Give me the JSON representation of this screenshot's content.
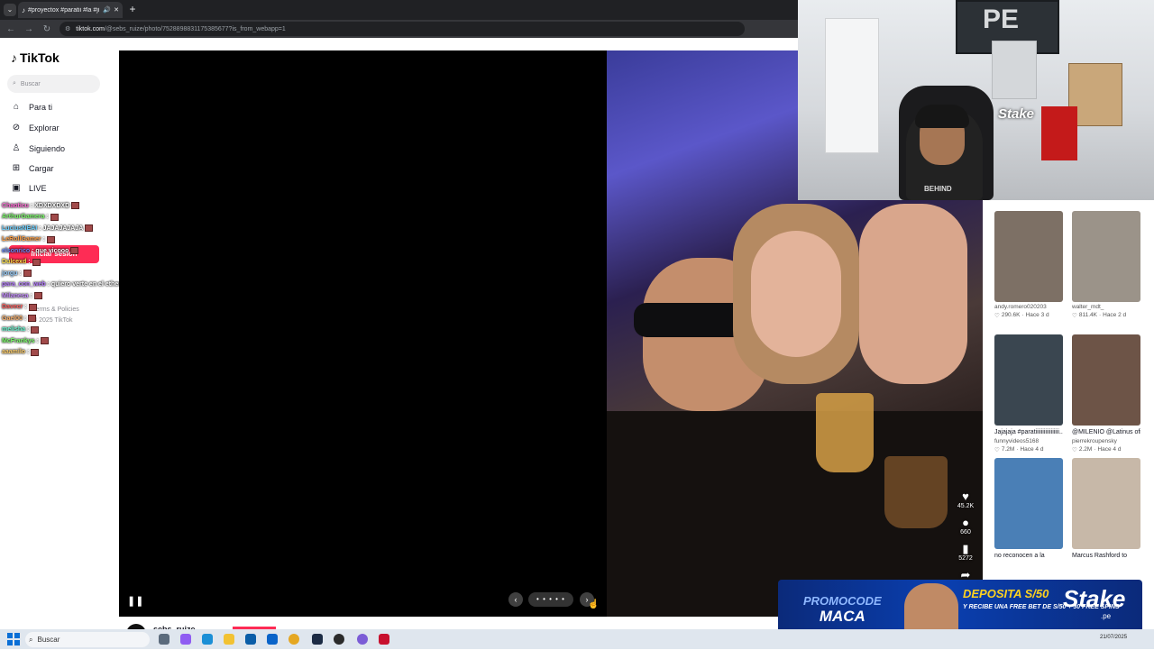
{
  "browser": {
    "tab_title": "#proyectox #paratii #la #ji",
    "url_host": "tiktok.com",
    "url_path": "/@sebs_ruize/photo/7528898831175385677?is_from_webapp=1"
  },
  "tiktok": {
    "logo": "TikTok",
    "search_placeholder": "Buscar",
    "nav": [
      {
        "label": "Para ti",
        "icon": "home-icon"
      },
      {
        "label": "Explorar",
        "icon": "compass-icon"
      },
      {
        "label": "Siguiendo",
        "icon": "following-icon"
      },
      {
        "label": "Cargar",
        "icon": "upload-icon"
      },
      {
        "label": "LIVE",
        "icon": "live-icon"
      }
    ],
    "login_label": "Iniciar sesión",
    "footer_terms": "Terms & Policies",
    "footer_copy": "© 2025 TikTok",
    "profile_name": "sebs_ruize"
  },
  "chat": [
    {
      "user": "Chaoticu",
      "text": ": XDXDXDXD",
      "color": "#ff6ad5"
    },
    {
      "user": "ArthurGamera",
      "text": ":",
      "color": "#7dff6b"
    },
    {
      "user": "LuciusNEAI",
      "text": ": JAJAJAJAJA",
      "color": "#6bd0ff"
    },
    {
      "user": "LeRollGamer",
      "text": ":",
      "color": "#ff9f45"
    },
    {
      "user": "elsonrico",
      "text": ": que vicooo",
      "color": "#6b8cff"
    },
    {
      "user": "Dulcexd",
      "text": ":",
      "color": "#ffe44d"
    },
    {
      "user": "jorgu",
      "text": ":",
      "color": "#9ad0ff"
    },
    {
      "user": "para_con_web",
      "text": ": quiero verte en el etherreal crj",
      "color": "#b57bff"
    },
    {
      "user": "Milanesa",
      "text": ":",
      "color": "#c58cff"
    },
    {
      "user": "Davecr",
      "text": ":",
      "color": "#ff5d5d"
    },
    {
      "user": "Gael00",
      "text": ":",
      "color": "#ffb36b"
    },
    {
      "user": "melisha",
      "text": ":",
      "color": "#6bffd6"
    },
    {
      "user": "McFrankys",
      "text": ":",
      "color": "#7dff6b"
    },
    {
      "user": "aaamilo",
      "text": ":",
      "color": "#ffcf6b"
    }
  ],
  "viewer": {
    "slide_dots": "• • • • •",
    "actions": {
      "likes": "45.2K",
      "comments": "660",
      "saves": "5272"
    }
  },
  "recommendations": [
    {
      "caption": "",
      "user": "andy.romero020203",
      "likes": "290.6K",
      "age": "Hace 3 d",
      "thumb": "#7d7065"
    },
    {
      "caption": "",
      "user": "walter_mdt_",
      "likes": "811.4K",
      "age": "Hace 2 d",
      "thumb": "#9b9389"
    },
    {
      "caption": "Jajajaja #paratiiiiiiiiiiiiiiiii...",
      "user": "funnyvideos5168",
      "likes": "7.2M",
      "age": "Hace 4 d",
      "thumb": "#3a4650"
    },
    {
      "caption": "@MILENIO @Latinus oficial @REFORMA...",
      "user": "pierrekroupensky",
      "likes": "2.2M",
      "age": "Hace 4 d",
      "thumb": "#6d5447"
    },
    {
      "caption": "no reconocen a la",
      "user": "",
      "likes": "",
      "age": "",
      "thumb": "#4a7fb6"
    },
    {
      "caption": "Marcus Rashford to",
      "user": "",
      "likes": "",
      "age": "",
      "thumb": "#c7b8a8"
    }
  ],
  "webcam": {
    "tv_text": "PE",
    "shirt_text": "BEHIND",
    "sign_text": "Stake"
  },
  "promo": {
    "left_top": "PROMOCODE",
    "left_bottom": "MACA",
    "mid_top": "DEPOSITA S/50",
    "mid_bottom": "Y RECIBE UNA FREE BET DE S/50 + 30 FREE SPINS",
    "logo": "Stake",
    "logo_sub": ".pe"
  },
  "taskbar": {
    "search_label": "Buscar",
    "date": "21/07/2025"
  }
}
